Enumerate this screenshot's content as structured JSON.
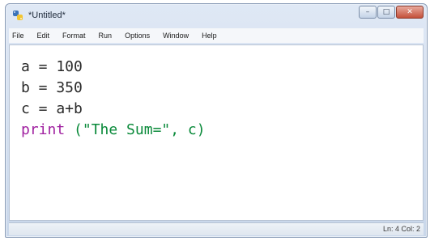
{
  "window": {
    "title": "*Untitled*",
    "controls": {
      "minimize": "–",
      "maximize": "□",
      "close": "✕"
    }
  },
  "menubar": {
    "items": [
      {
        "label": "File"
      },
      {
        "label": "Edit"
      },
      {
        "label": "Format"
      },
      {
        "label": "Run"
      },
      {
        "label": "Options"
      },
      {
        "label": "Window"
      },
      {
        "label": "Help"
      }
    ]
  },
  "editor": {
    "lines": [
      {
        "text": "a = 100"
      },
      {
        "text": "b = 350"
      },
      {
        "text": "c = a+b"
      },
      {
        "keyword": "print",
        "open": " (",
        "string": "\"The Sum=\"",
        "rest": ", c)"
      }
    ]
  },
  "status": {
    "line": "Ln: 4",
    "col": "Col: 2"
  },
  "colors": {
    "keyword": "#a020a0",
    "string": "#0a8a3a",
    "plain": "#2a2a2a"
  }
}
